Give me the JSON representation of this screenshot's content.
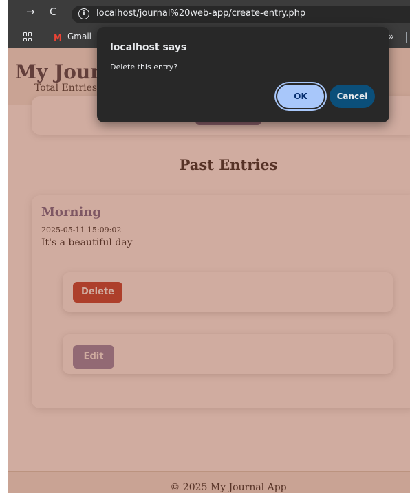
{
  "browser": {
    "url": "localhost/journal%20web-app/create-entry.php",
    "nav": {
      "back": "←",
      "forward": "→",
      "reload": "C"
    },
    "info_icon": "i",
    "bookmarks": [
      {
        "label": "Gmail",
        "icon": "gmail-icon"
      }
    ],
    "gmail_glyph": "M",
    "more": "»"
  },
  "page": {
    "app_title": "My Journal App",
    "total_entries": "Total Entries: 1",
    "section_title": "Past Entries",
    "entries": [
      {
        "title": "Morning",
        "date": "2025-05-11 15:09:02",
        "content": "It's a beautiful day",
        "delete_label": "Delete",
        "edit_label": "Edit"
      }
    ],
    "footer": "© 2025 My Journal App"
  },
  "dialog": {
    "title": "localhost says",
    "message": "Delete this entry?",
    "ok_label": "OK",
    "cancel_label": "Cancel"
  },
  "colors": {
    "overlay": "#964629",
    "delete_button": "#c0392b",
    "edit_button": "#8e86b0",
    "accent": "#6b6591",
    "dialog_ok": "#a8c7fa",
    "dialog_cancel": "#0b4f7a"
  }
}
